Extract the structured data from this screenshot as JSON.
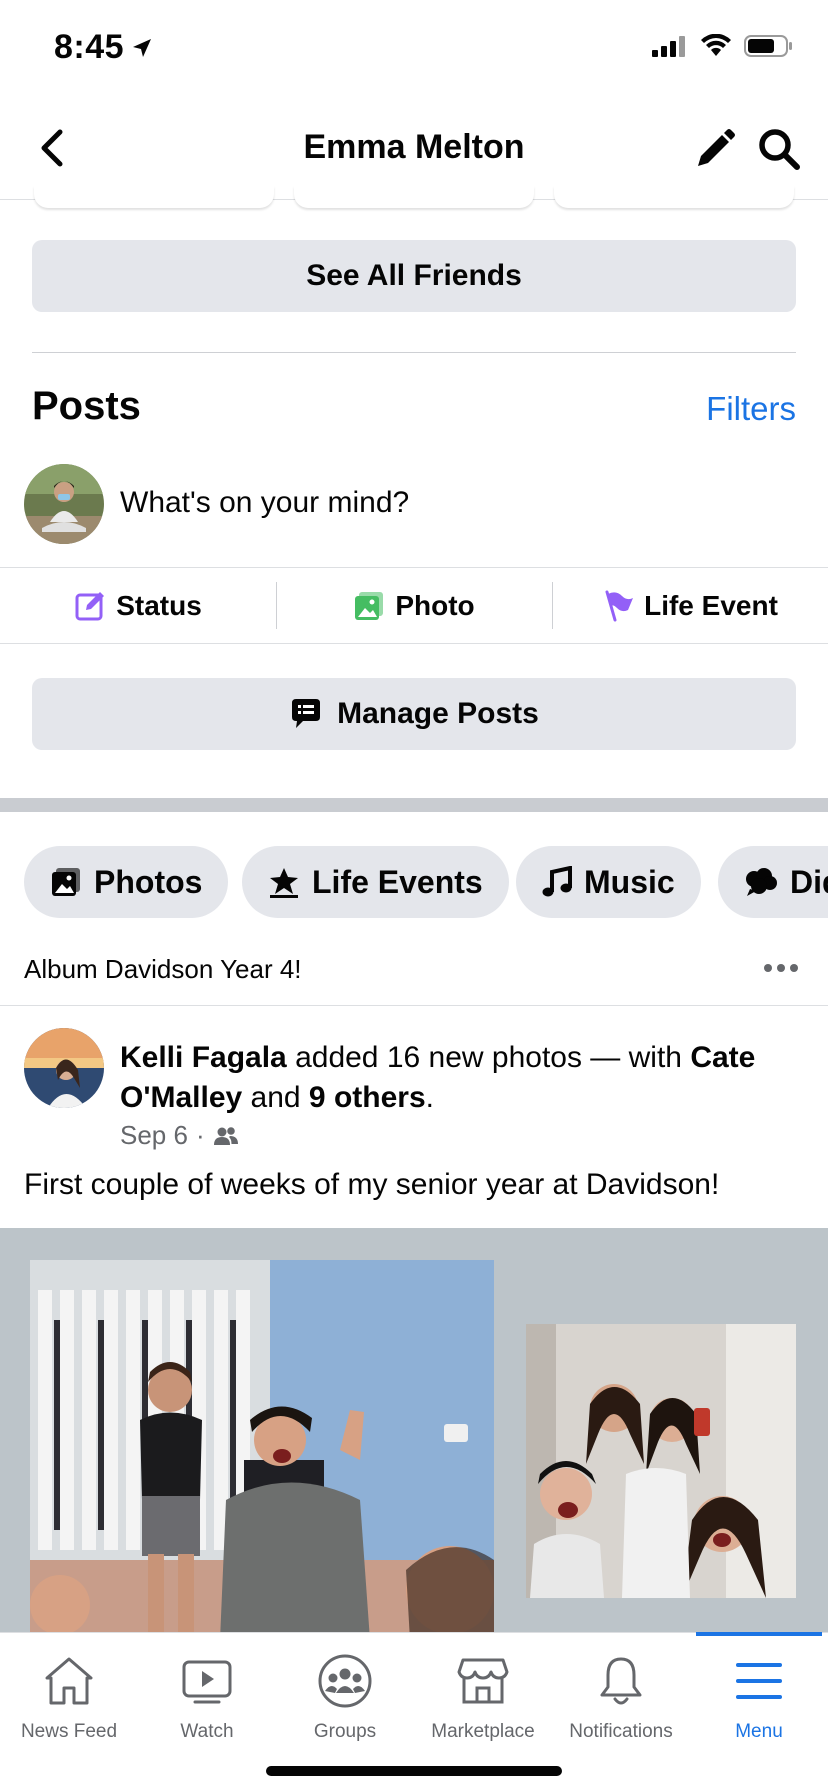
{
  "status_bar": {
    "time": "8:45"
  },
  "nav": {
    "title": "Emma Melton"
  },
  "friends": {
    "see_all_label": "See All Friends"
  },
  "posts": {
    "heading": "Posts",
    "filters_label": "Filters",
    "composer_prompt": "What's on your mind?",
    "actions": [
      {
        "label": "Status",
        "icon": "edit-square-icon",
        "color": "#9360f7"
      },
      {
        "label": "Photo",
        "icon": "photo-icon",
        "color": "#45bd62"
      },
      {
        "label": "Life Event",
        "icon": "flag-icon",
        "color": "#9360f7"
      }
    ],
    "manage_label": "Manage Posts"
  },
  "chips": [
    {
      "label": "Photos",
      "icon": "photos-icon"
    },
    {
      "label": "Life Events",
      "icon": "life-events-icon"
    },
    {
      "label": "Music",
      "icon": "music-note-icon"
    },
    {
      "label": "Did",
      "icon": "speech-bubble-icon"
    }
  ],
  "album": {
    "title": "Album Davidson Year 4!"
  },
  "post": {
    "author": "Kelli Fagala",
    "action_text": " added 16 new photos — with ",
    "tagged_1": "Cate O'Malley",
    "and_text": " and ",
    "tagged_others": "9 others",
    "period": ".",
    "date": "Sep 6",
    "separator": "·",
    "audience_icon": "friends-icon",
    "body": "First couple of weeks of my senior year at Davidson!"
  },
  "tab_bar": {
    "tabs": [
      {
        "label": "News Feed",
        "icon": "home-icon",
        "active": false
      },
      {
        "label": "Watch",
        "icon": "watch-icon",
        "active": false
      },
      {
        "label": "Groups",
        "icon": "groups-icon",
        "active": false
      },
      {
        "label": "Marketplace",
        "icon": "marketplace-icon",
        "active": false
      },
      {
        "label": "Notifications",
        "icon": "bell-icon",
        "active": false
      },
      {
        "label": "Menu",
        "icon": "menu-icon",
        "active": true
      }
    ]
  },
  "colors": {
    "accent": "#1b74e4",
    "chip_bg": "#e4e6eb",
    "section_gray": "#c9ccd1"
  }
}
